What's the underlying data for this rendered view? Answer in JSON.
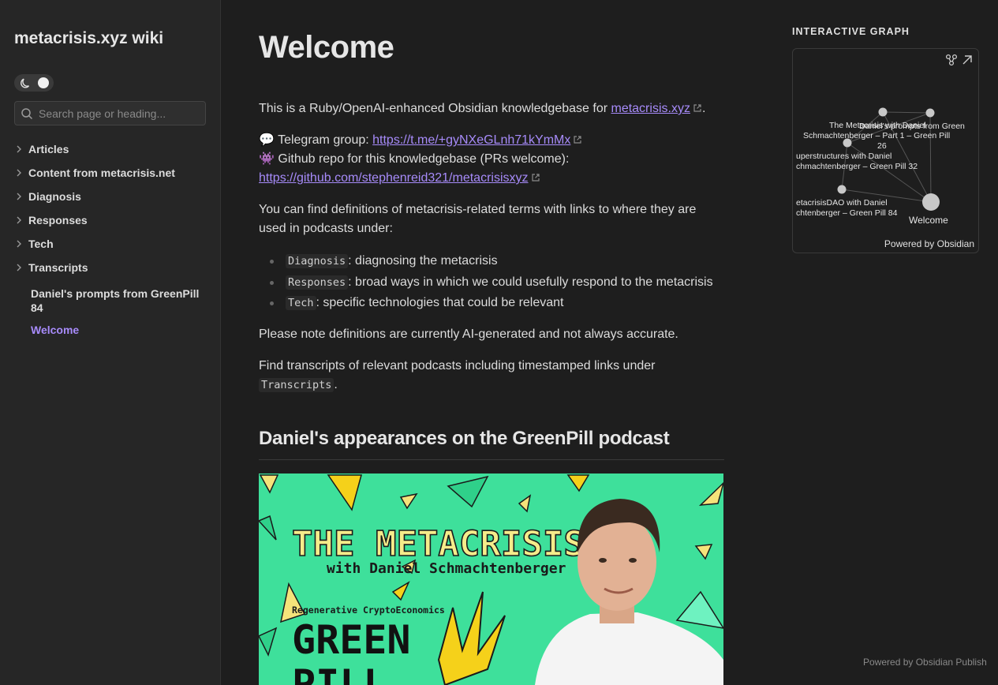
{
  "site": {
    "title": "metacrisis.xyz wiki"
  },
  "search": {
    "placeholder": "Search page or heading..."
  },
  "nav": {
    "folders": [
      "Articles",
      "Content from metacrisis.net",
      "Diagnosis",
      "Responses",
      "Tech",
      "Transcripts"
    ],
    "files": [
      {
        "label": "Daniel's prompts from GreenPill 84",
        "active": false
      },
      {
        "label": "Welcome",
        "active": true
      }
    ]
  },
  "page": {
    "title": "Welcome",
    "intro_text": "This is a Ruby/OpenAI-enhanced Obsidian knowledgebase for ",
    "intro_link": "metacrisis.xyz",
    "intro_end": ".",
    "telegram_text": "💬 Telegram group: ",
    "telegram_link": "https://t.me/+gyNXeGLnh71kYmMx",
    "github_text": "👾 Github repo for this knowledgebase (PRs welcome):",
    "github_link": "https://github.com/stephenreid321/metacrisisxyz",
    "definitions_text": "You can find definitions of metacrisis-related terms with links to where they are used in podcasts under:",
    "definitions": [
      {
        "code": "Diagnosis",
        "desc": ": diagnosing the metacrisis"
      },
      {
        "code": "Responses",
        "desc": ": broad ways in which we could usefully respond to the metacrisis"
      },
      {
        "code": "Tech",
        "desc": ": specific technologies that could be relevant"
      }
    ],
    "note_text": "Please note definitions are currently AI-generated and not always accurate.",
    "transcripts_text": "Find transcripts of relevant podcasts including timestamped links under",
    "transcripts_code": "Transcripts",
    "transcripts_end": ".",
    "section_heading": "Daniel's appearances on the GreenPill podcast",
    "banner": {
      "title": "THE METACRISIS",
      "subtitle": "with Daniel Schmachtenberger",
      "tagline": "Regenerative CryptoEconomics",
      "logo_line1": "GREEN",
      "logo_line2": "PILL"
    }
  },
  "graph": {
    "heading": "INTERACTIVE GRAPH",
    "powered": "Powered by Obsidian",
    "labels": [
      "The Metacrisis with Daniel",
      "Daniel's prompts from Green",
      "Schmachtenberger – Part 1 – Green Pill",
      "26",
      "uperstructures with Daniel",
      "chmachtenberger – Green Pill 32",
      "etacrisisDAO with Daniel",
      "chtenberger – Green Pill 84",
      "Welcome"
    ]
  },
  "footer": {
    "powered": "Powered by Obsidian Publish"
  },
  "colors": {
    "accent": "#a78bfa",
    "banner_bg": "#3ee09b",
    "background": "#1e1e1e",
    "sidebar": "#262626"
  }
}
